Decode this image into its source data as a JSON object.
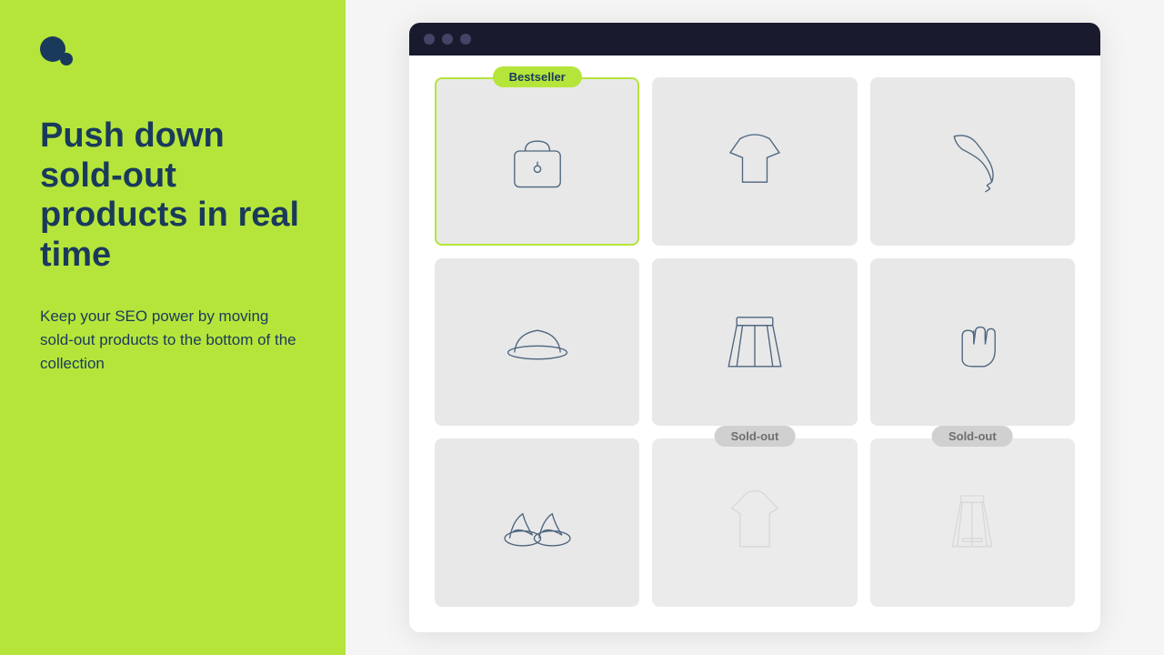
{
  "logo": {
    "aria": "App logo"
  },
  "left": {
    "headline": "Push down sold-out products in real time",
    "subtext": "Keep your SEO power by moving sold-out products to the bottom of the collection"
  },
  "right": {
    "products": [
      {
        "id": 1,
        "badge": "Bestseller",
        "badge_type": "bestseller",
        "icon": "handbag",
        "sold_out": false
      },
      {
        "id": 2,
        "badge": null,
        "badge_type": null,
        "icon": "top",
        "sold_out": false
      },
      {
        "id": 3,
        "badge": null,
        "badge_type": null,
        "icon": "scarf",
        "sold_out": false
      },
      {
        "id": 4,
        "badge": null,
        "badge_type": null,
        "icon": "hat",
        "sold_out": false
      },
      {
        "id": 5,
        "badge": null,
        "badge_type": null,
        "icon": "skirt",
        "sold_out": false
      },
      {
        "id": 6,
        "badge": null,
        "badge_type": null,
        "icon": "gloves",
        "sold_out": false
      },
      {
        "id": 7,
        "badge": null,
        "badge_type": null,
        "icon": "sandals",
        "sold_out": false
      },
      {
        "id": 8,
        "badge": "Sold-out",
        "badge_type": "soldout",
        "icon": "tank-top",
        "sold_out": true
      },
      {
        "id": 9,
        "badge": "Sold-out",
        "badge_type": "soldout",
        "icon": "dress",
        "sold_out": true
      }
    ]
  }
}
